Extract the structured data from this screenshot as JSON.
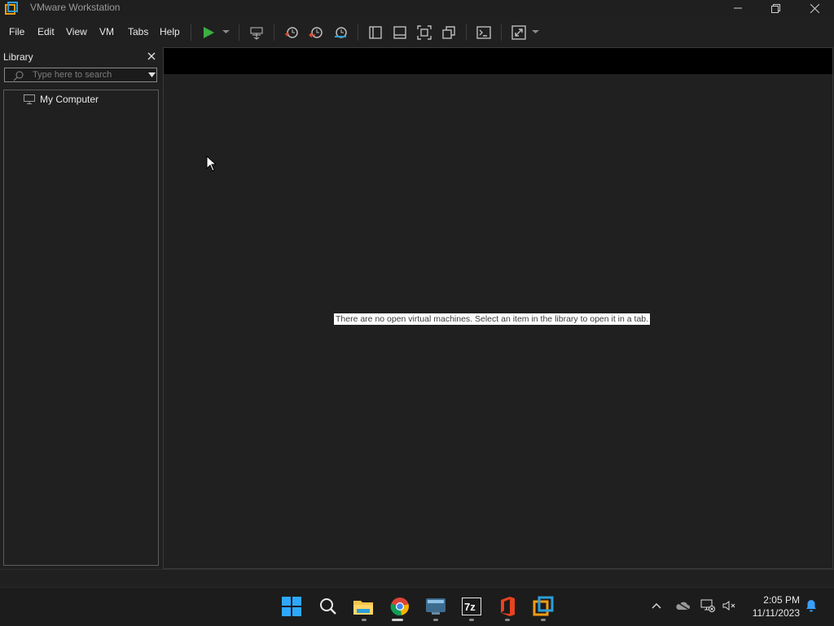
{
  "window": {
    "title": "VMware Workstation"
  },
  "menu": [
    "File",
    "Edit",
    "View",
    "VM",
    "Tabs",
    "Help"
  ],
  "toolbar": {
    "icons": [
      "play-icon",
      "send-ctrl-alt-del-icon",
      "snapshot-icon",
      "revert-snapshot-icon",
      "snapshot-manager-icon",
      "show-library-icon",
      "show-thumbnail-bar-icon",
      "full-screen-icon",
      "unity-icon",
      "console-view-icon",
      "stretch-guest-icon"
    ]
  },
  "library": {
    "title": "Library",
    "search_placeholder": "Type here to search",
    "items": [
      {
        "label": "My Computer",
        "icon": "computer-icon"
      }
    ]
  },
  "main": {
    "empty_message": "There are no open virtual machines. Select an item in the library to open it in a tab."
  },
  "taskbar": {
    "apps": [
      "start-icon",
      "search-icon",
      "file-explorer-icon",
      "chrome-icon",
      "vm-desktop-icon",
      "7zip-icon",
      "office-icon",
      "vmware-icon"
    ],
    "time": "2:05 PM",
    "date": "11/11/2023"
  },
  "colors": {
    "play": "#3cb043",
    "accent": "#0078d4",
    "background": "#202020"
  }
}
